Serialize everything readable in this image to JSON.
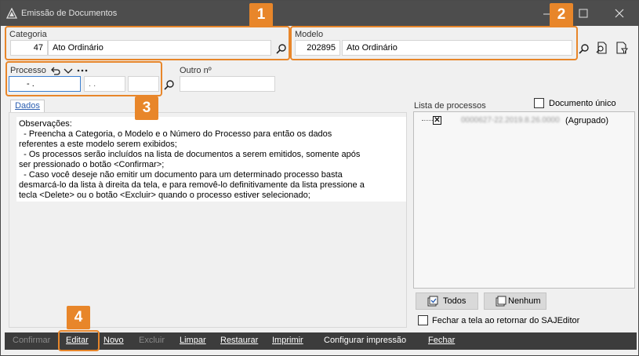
{
  "window": {
    "title": "Emissão de Documentos",
    "minimize_icon": "minimize-icon",
    "maximize_icon": "maximize-icon",
    "close_icon": "close-icon"
  },
  "categoria": {
    "label": "Categoria",
    "code": "47",
    "name": "Ato Ordinário"
  },
  "modelo": {
    "label": "Modelo",
    "code": "202895",
    "name": "Ato Ordinário"
  },
  "processo": {
    "label": "Processo",
    "field1": "-  .",
    "field2": ".  .",
    "field3": "",
    "outro_label": "Outro nº",
    "outro_value": ""
  },
  "tabs": [
    {
      "label": "Dados"
    }
  ],
  "observacoes": "Observações:\n  - Preencha a Categoria, o Modelo e o Número do Processo para então os dados\nreferentes a este modelo serem exibidos;\n  - Os processos serão incluídos na lista de documentos a serem emitidos, somente após\nser pressionado o botão <Confirmar>;\n  - Caso você deseje não emitir um documento para um determinado processo basta\ndesmarcá-lo da lista à direita da tela, e para removê-lo definitivamente da lista pressione a\ntecla <Delete> ou o botão <Excluir> quando o processo estiver selecionado;",
  "lista": {
    "label": "Lista de processos",
    "documento_unico": "Documento único",
    "items": [
      {
        "process_number": "0000627-22.2019.8.26.0000",
        "suffix": "(Agrupado)",
        "checked": true
      }
    ],
    "todos_label": "Todos",
    "nenhum_label": "Nenhum",
    "fechar_label": "Fechar a tela ao retornar do SAJEditor"
  },
  "toolbar": {
    "confirmar": "Confirmar",
    "editar": "Editar",
    "novo": "Novo",
    "excluir": "Excluir",
    "limpar": "Limpar",
    "restaurar": "Restaurar",
    "imprimir": "Imprimir",
    "configurar": "Configurar impressão",
    "fechar": "Fechar"
  },
  "badges": {
    "b1": "1",
    "b2": "2",
    "b3": "3",
    "b4": "4"
  },
  "colors": {
    "accent": "#e8862a",
    "titlebar": "#4d4d4d",
    "toolbar": "#3c3c3c"
  }
}
